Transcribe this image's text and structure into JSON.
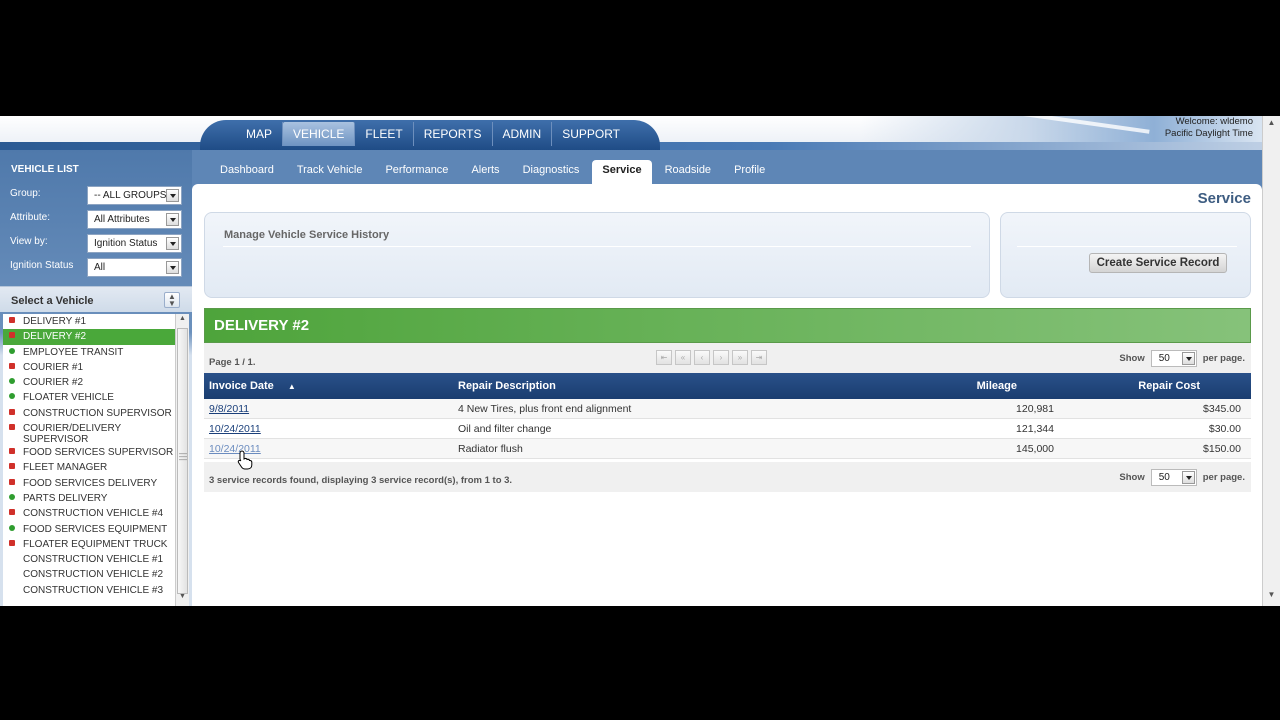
{
  "header": {
    "nav": [
      "MAP",
      "VEHICLE",
      "FLEET",
      "REPORTS",
      "ADMIN",
      "SUPPORT"
    ],
    "active_nav": "VEHICLE",
    "welcome": "Welcome: wldemo",
    "timezone": "Pacific Daylight Time"
  },
  "sidebar": {
    "title": "VEHICLE LIST",
    "filters": [
      {
        "label": "Group:",
        "value": "-- ALL GROUPS"
      },
      {
        "label": "Attribute:",
        "value": "All Attributes"
      },
      {
        "label": "View by:",
        "value": "Ignition Status"
      },
      {
        "label": "Ignition Status",
        "value": "All"
      }
    ],
    "select_title": "Select a Vehicle",
    "vehicles": [
      {
        "name": "DELIVERY #1",
        "status": "red"
      },
      {
        "name": "DELIVERY #2",
        "status": "red",
        "selected": true
      },
      {
        "name": "EMPLOYEE TRANSIT",
        "status": "green"
      },
      {
        "name": "COURIER #1",
        "status": "red"
      },
      {
        "name": "COURIER #2",
        "status": "green"
      },
      {
        "name": "FLOATER VEHICLE",
        "status": "green"
      },
      {
        "name": "CONSTRUCTION SUPERVISOR",
        "status": "red"
      },
      {
        "name": "COURIER/DELIVERY SUPERVISOR",
        "status": "red"
      },
      {
        "name": "FOOD SERVICES SUPERVISOR",
        "status": "red"
      },
      {
        "name": "FLEET MANAGER",
        "status": "red"
      },
      {
        "name": "FOOD SERVICES DELIVERY",
        "status": "red"
      },
      {
        "name": "PARTS DELIVERY",
        "status": "green"
      },
      {
        "name": "CONSTRUCTION VEHICLE #4",
        "status": "red"
      },
      {
        "name": "FOOD SERVICES EQUIPMENT",
        "status": "green"
      },
      {
        "name": "FLOATER EQUIPMENT TRUCK",
        "status": "red"
      },
      {
        "name": "CONSTRUCTION VEHICLE #1",
        "status": "none"
      },
      {
        "name": "CONSTRUCTION VEHICLE #2",
        "status": "none"
      },
      {
        "name": "CONSTRUCTION VEHICLE #3",
        "status": "none"
      }
    ]
  },
  "tabs": [
    "Dashboard",
    "Track Vehicle",
    "Performance",
    "Alerts",
    "Diagnostics",
    "Service",
    "Roadside",
    "Profile"
  ],
  "active_tab": "Service",
  "main": {
    "page_title": "Service",
    "panel_title": "Manage Vehicle Service History",
    "create_button": "Create Service Record",
    "vehicle_name": "DELIVERY #2",
    "page_info": "Page 1 / 1.",
    "show_label": "Show",
    "per_page_label": "per page.",
    "page_size": "50",
    "columns": [
      "Invoice Date",
      "Repair Description",
      "Mileage",
      "Repair Cost"
    ],
    "rows": [
      {
        "date": "9/8/2011",
        "desc": "4 New Tires, plus front end alignment",
        "mileage": "120,981",
        "cost": "$345.00"
      },
      {
        "date": "10/24/2011",
        "desc": "Oil and filter change",
        "mileage": "121,344",
        "cost": "$30.00"
      },
      {
        "date": "10/24/2011",
        "desc": "Radiator flush",
        "mileage": "145,000",
        "cost": "$150.00"
      }
    ],
    "footer_info": "3 service records found, displaying 3 service record(s), from 1 to 3."
  },
  "colors": {
    "nav_blue": "#1f4c86",
    "vehicle_header_green": "#4ea43b",
    "grid_header": "#2a5189",
    "status_red": "#d0302a",
    "status_green": "#2f9d2f"
  }
}
